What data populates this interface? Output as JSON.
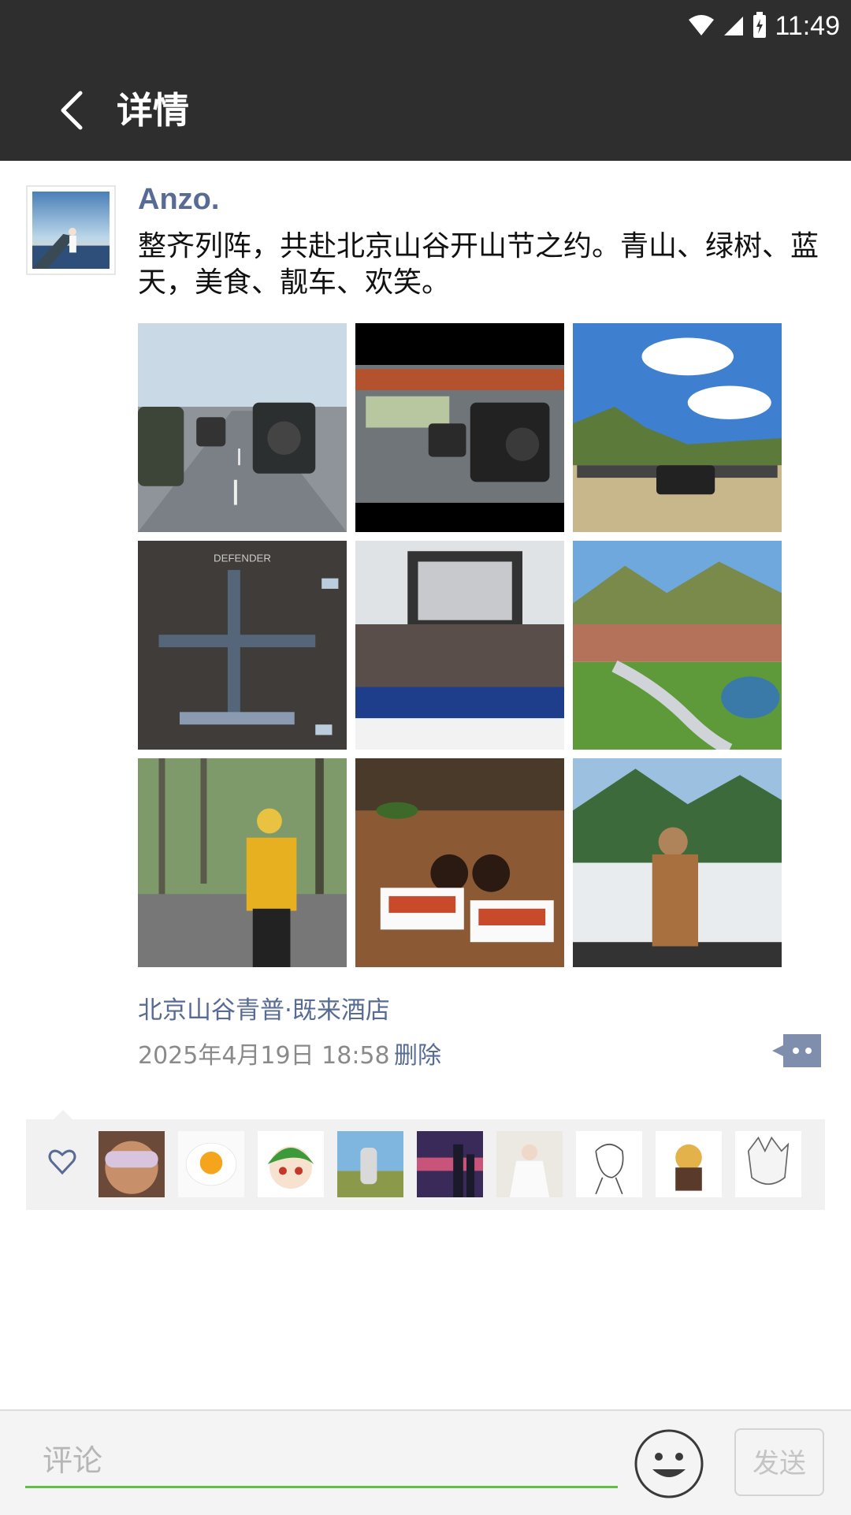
{
  "status_bar": {
    "time": "11:49",
    "icons": [
      "wifi-icon",
      "cellular-signal-icon",
      "battery-charging-icon"
    ]
  },
  "header": {
    "title": "详情",
    "back_icon": "back-arrow-icon",
    "background": "#2e2e2e"
  },
  "post": {
    "author": "Anzo.",
    "text": "整齐列阵，共赴北京山谷开山节之约。青山、绿树、蓝天，美食、靓车、欢笑。",
    "photos": [
      "photo-convoy-highway",
      "photo-convoy-tunnel",
      "photo-cars-parked-mountain",
      "photo-aerial-cross-formation",
      "photo-group-banner",
      "photo-village-landscape",
      "photo-woman-forest",
      "photo-hotdogs-coffee",
      "photo-woman-mountain-view"
    ],
    "location": "北京山谷青普·既来酒店",
    "timestamp": "2025年4月19日 18:58",
    "delete_label": "删除",
    "more_icon": "comment-more-icon"
  },
  "likes": {
    "icon": "heart-icon",
    "avatars": [
      "liker-avatar-1",
      "liker-avatar-2",
      "liker-avatar-3",
      "liker-avatar-4",
      "liker-avatar-5",
      "liker-avatar-6",
      "liker-avatar-7",
      "liker-avatar-8",
      "liker-avatar-9"
    ]
  },
  "comment_bar": {
    "placeholder": "评论",
    "value": "",
    "emoji_icon": "emoji-smiley-icon",
    "send_label": "发送"
  },
  "colors": {
    "link": "#576b95",
    "accent": "#62c041",
    "header": "#2e2e2e"
  }
}
